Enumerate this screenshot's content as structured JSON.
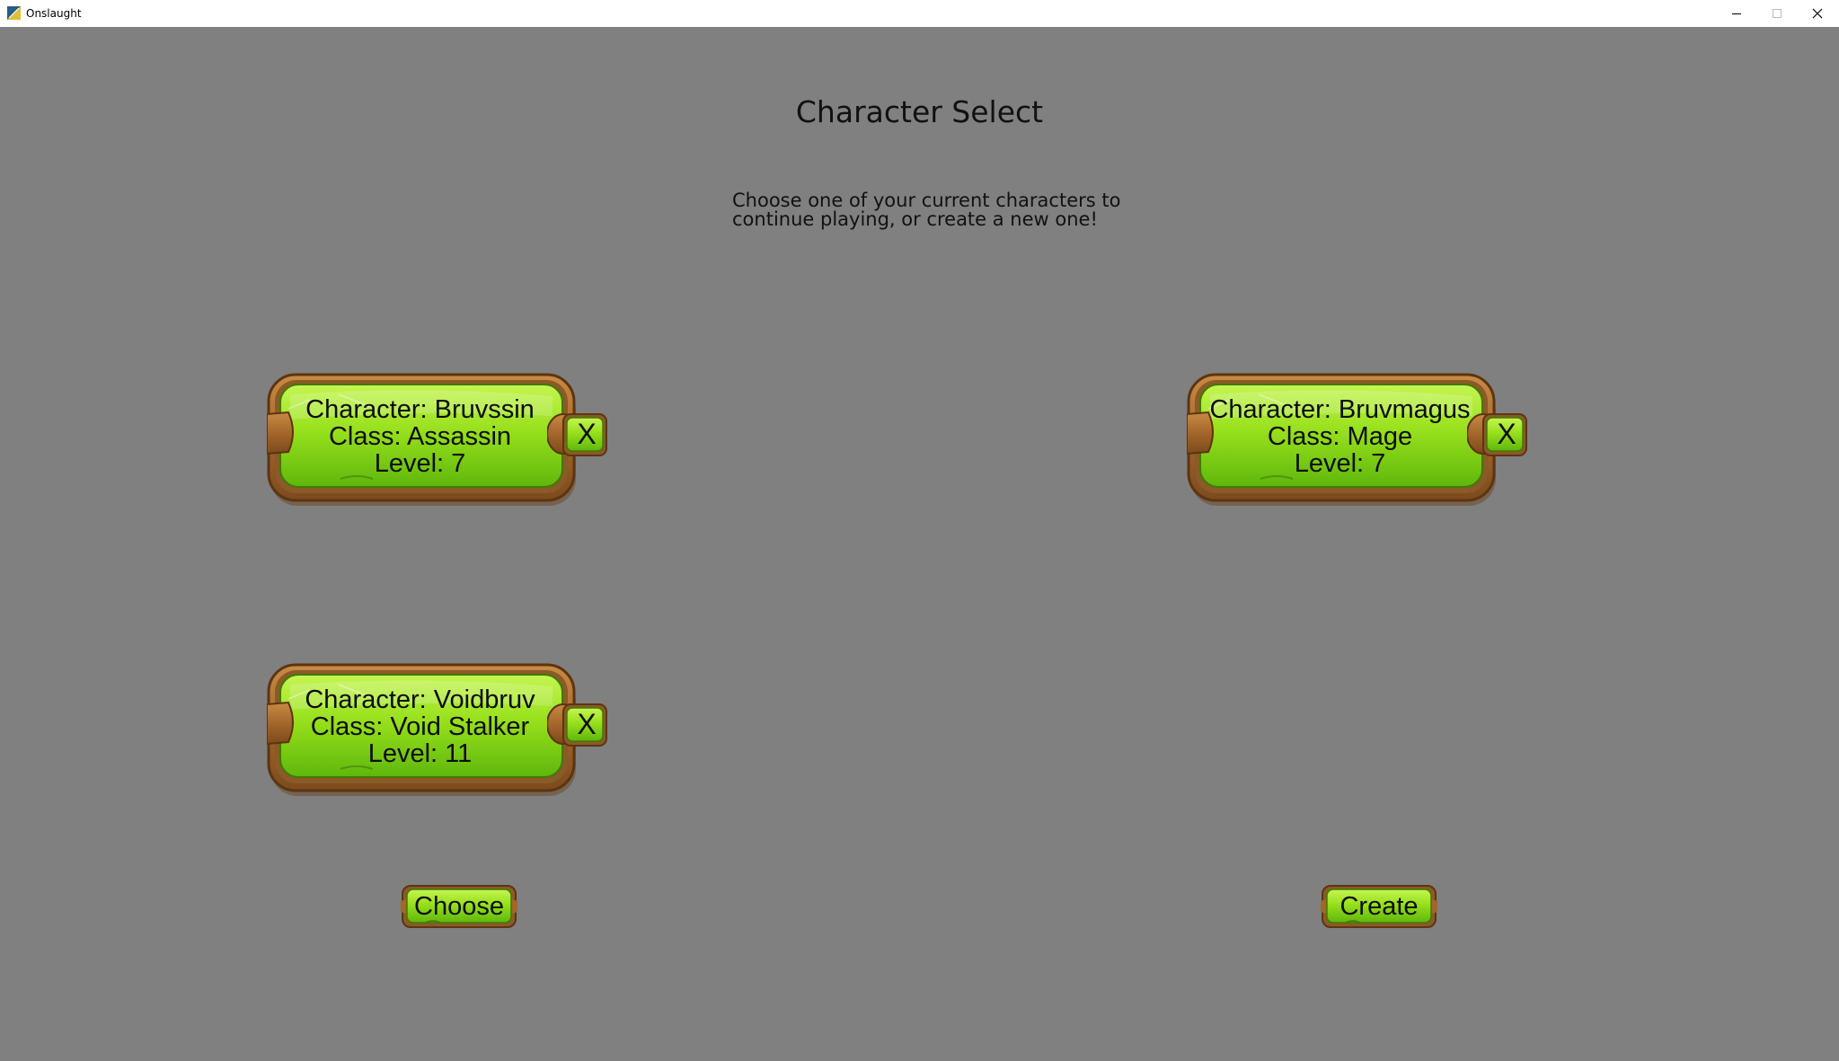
{
  "window": {
    "title": "Onslaught",
    "icons": {
      "app": "onslaught-app-icon",
      "minimize": "minimize-icon",
      "maximize": "maximize-icon",
      "close": "close-icon"
    }
  },
  "screen": {
    "heading": "Character Select",
    "instructions": [
      "Choose one of your current characters to",
      "continue playing, or create a new one!"
    ]
  },
  "characters": [
    {
      "name_line": "Character: Bruvssin",
      "class_line": "Class: Assassin",
      "level_line": "Level: 7",
      "delete_label": "X"
    },
    {
      "name_line": "Character: Bruvmagus",
      "class_line": "Class: Mage",
      "level_line": "Level: 7",
      "delete_label": "X"
    },
    {
      "name_line": "Character: Voidbruv",
      "class_line": "Class: Void Stalker",
      "level_line": "Level: 11",
      "delete_label": "X"
    }
  ],
  "actions": {
    "choose_label": "Choose",
    "create_label": "Create"
  },
  "colors": {
    "background": "#808080",
    "button_green": "#8fdc1a",
    "button_green_light": "#b9f04a",
    "frame_brown": "#a8692b",
    "frame_brown_dark": "#6e4118",
    "titlebar": "#ffffff"
  }
}
